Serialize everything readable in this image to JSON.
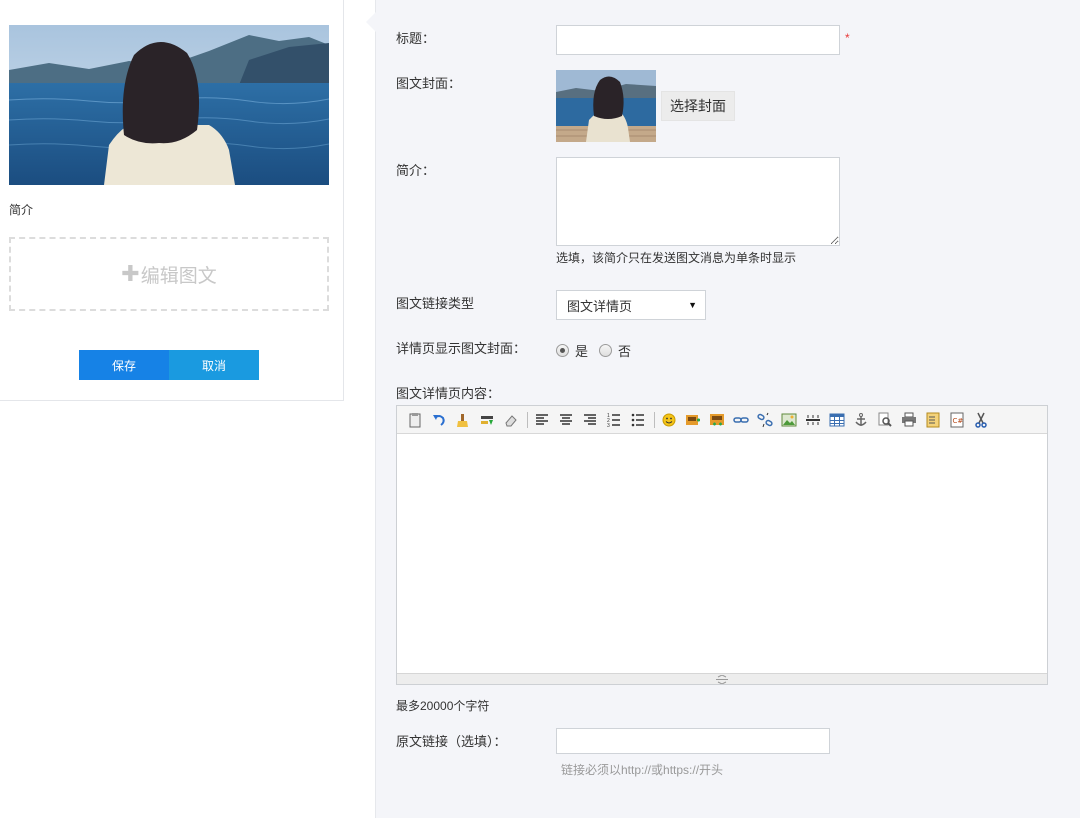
{
  "preview": {
    "summary_label": "简介",
    "edit_box_text": "编辑图文",
    "save_label": "保存",
    "cancel_label": "取消"
  },
  "form": {
    "title_label": "标题：",
    "title_value": "",
    "required_mark": "*",
    "cover_label": "图文封面：",
    "choose_cover_label": "选择封面",
    "summary_label": "简介：",
    "summary_value": "",
    "summary_hint": "选填，该简介只在发送图文消息为单条时显示",
    "link_type_label": "图文链接类型",
    "link_type_selected": "图文详情页",
    "show_cover_label": "详情页显示图文封面：",
    "yes_label": "是",
    "no_label": "否",
    "show_cover_selected": "是",
    "content_label": "图文详情页内容：",
    "content_limit_hint": "最多20000个字符",
    "source_link_label": "原文链接（选填）：",
    "source_link_value": "",
    "source_link_hint": "链接必须以http://或https://开头"
  },
  "editor_toolbar": {
    "groups": [
      [
        "paste-icon",
        "undo-icon",
        "format-painter-icon",
        "highlight-icon",
        "eraser-icon"
      ],
      [
        "align-left-icon",
        "align-center-icon",
        "align-right-icon",
        "ordered-list-icon",
        "unordered-list-icon"
      ],
      [
        "emoji-icon",
        "insert-image-icon",
        "insert-multi-image-icon",
        "link-icon",
        "unlink-icon",
        "image-icon",
        "horizontal-rule-icon",
        "table-icon",
        "anchor-icon",
        "preview-icon",
        "print-icon",
        "template-icon",
        "code-icon",
        "cut-icon"
      ]
    ]
  },
  "colors": {
    "save_button": "#1682e6",
    "cancel_button": "#1a9ae0",
    "form_bg": "#f4f5f9",
    "required": "#e83a3a"
  }
}
